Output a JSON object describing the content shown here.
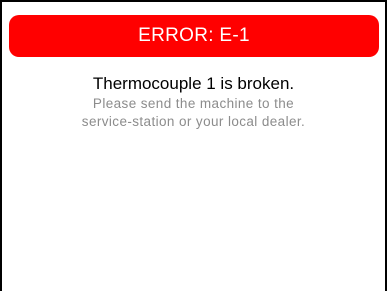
{
  "error": {
    "title": "ERROR: E-1",
    "banner_color": "#ff0000"
  },
  "message": {
    "title": "Thermocouple 1 is broken.",
    "detail_line_1": "Please send the machine to the",
    "detail_line_2": "service-station or your local dealer."
  }
}
